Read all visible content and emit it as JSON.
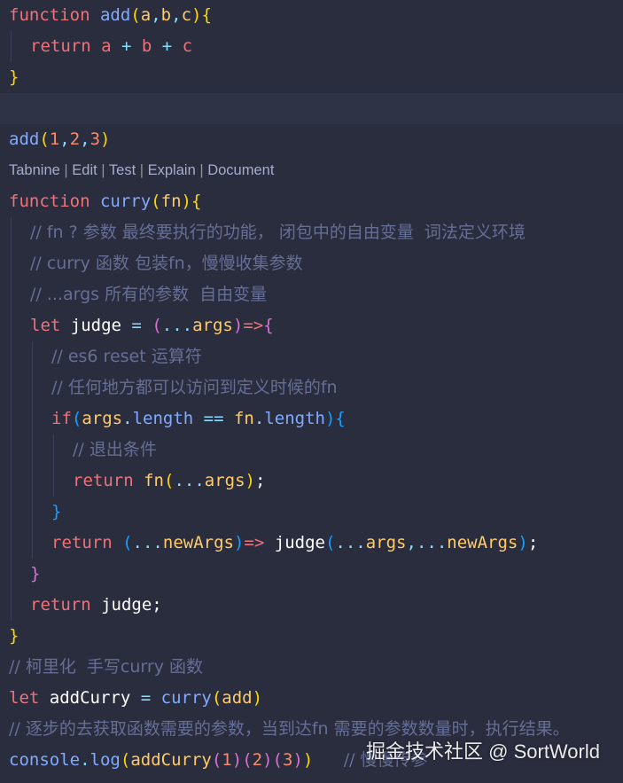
{
  "theme": {
    "background": "#292d3e",
    "keyword": "#f07178",
    "function": "#82aaff",
    "variable": "#ffcb6b",
    "operator": "#89ddff",
    "number": "#f78c6c",
    "comment": "#676e95",
    "bracket_level_1": "#ffd700",
    "bracket_level_2": "#da70d6",
    "bracket_level_3": "#179fff"
  },
  "codelens": {
    "items": [
      "Tabnine",
      "Edit",
      "Test",
      "Explain",
      "Document"
    ],
    "separator": " | "
  },
  "watermark": "掘金技术社区 @ SortWorld",
  "lines": [
    {
      "tokens": [
        {
          "t": "function",
          "c": "kw"
        },
        {
          "t": " ",
          "c": "tx"
        },
        {
          "t": "add",
          "c": "fn"
        },
        {
          "t": "(",
          "c": "b1"
        },
        {
          "t": "a",
          "c": "var"
        },
        {
          "t": ",",
          "c": "op"
        },
        {
          "t": "b",
          "c": "var"
        },
        {
          "t": ",",
          "c": "op"
        },
        {
          "t": "c",
          "c": "var"
        },
        {
          "t": ")",
          "c": "b1"
        },
        {
          "t": "{",
          "c": "b1"
        }
      ]
    },
    {
      "indent": 1,
      "tokens": [
        {
          "t": "return",
          "c": "kw"
        },
        {
          "t": " a ",
          "c": "kw"
        },
        {
          "t": "+",
          "c": "op"
        },
        {
          "t": " b ",
          "c": "kw"
        },
        {
          "t": "+",
          "c": "op"
        },
        {
          "t": " c",
          "c": "kw"
        }
      ]
    },
    {
      "tokens": [
        {
          "t": "}",
          "c": "b1"
        }
      ]
    },
    {
      "highlight": true,
      "tokens": []
    },
    {
      "tokens": [
        {
          "t": "add",
          "c": "fn"
        },
        {
          "t": "(",
          "c": "b1"
        },
        {
          "t": "1",
          "c": "num"
        },
        {
          "t": ",",
          "c": "op"
        },
        {
          "t": "2",
          "c": "num"
        },
        {
          "t": ",",
          "c": "op"
        },
        {
          "t": "3",
          "c": "num"
        },
        {
          "t": ")",
          "c": "b1"
        }
      ]
    },
    {
      "codelens": true
    },
    {
      "tokens": [
        {
          "t": "function",
          "c": "kw"
        },
        {
          "t": " ",
          "c": "tx"
        },
        {
          "t": "curry",
          "c": "fn"
        },
        {
          "t": "(",
          "c": "b1"
        },
        {
          "t": "fn",
          "c": "var"
        },
        {
          "t": ")",
          "c": "b1"
        },
        {
          "t": "{",
          "c": "b1"
        }
      ]
    },
    {
      "indent": 1,
      "tokens": [
        {
          "t": "// fn ? 参数 最终要执行的功能， 闭包中的自由变量  词法定义环境",
          "c": "cm"
        }
      ]
    },
    {
      "indent": 1,
      "tokens": [
        {
          "t": "// curry 函数 包装fn，慢慢收集参数",
          "c": "cm"
        }
      ]
    },
    {
      "indent": 1,
      "tokens": [
        {
          "t": "// ...args 所有的参数  自由变量",
          "c": "cm"
        }
      ]
    },
    {
      "indent": 1,
      "tokens": [
        {
          "t": "let",
          "c": "kw"
        },
        {
          "t": " ",
          "c": "tx"
        },
        {
          "t": "judge",
          "c": "pl"
        },
        {
          "t": " = ",
          "c": "op"
        },
        {
          "t": "(",
          "c": "b2"
        },
        {
          "t": "...",
          "c": "op"
        },
        {
          "t": "args",
          "c": "var"
        },
        {
          "t": ")",
          "c": "b2"
        },
        {
          "t": "=>",
          "c": "kw"
        },
        {
          "t": "{",
          "c": "b2"
        }
      ]
    },
    {
      "indent": 2,
      "tokens": [
        {
          "t": "// es6 reset 运算符",
          "c": "cm"
        }
      ]
    },
    {
      "indent": 2,
      "tokens": [
        {
          "t": "// 任何地方都可以访问到定义时候的fn",
          "c": "cm"
        }
      ]
    },
    {
      "indent": 2,
      "tokens": [
        {
          "t": "if",
          "c": "kw"
        },
        {
          "t": "(",
          "c": "b3"
        },
        {
          "t": "args",
          "c": "var"
        },
        {
          "t": ".",
          "c": "op"
        },
        {
          "t": "length",
          "c": "fn"
        },
        {
          "t": " == ",
          "c": "op"
        },
        {
          "t": "fn",
          "c": "var"
        },
        {
          "t": ".",
          "c": "op"
        },
        {
          "t": "length",
          "c": "fn"
        },
        {
          "t": ")",
          "c": "b3"
        },
        {
          "t": "{",
          "c": "b3"
        }
      ]
    },
    {
      "indent": 3,
      "tokens": [
        {
          "t": "// 退出条件",
          "c": "cm"
        }
      ]
    },
    {
      "indent": 3,
      "tokens": [
        {
          "t": "return",
          "c": "kw"
        },
        {
          "t": " ",
          "c": "tx"
        },
        {
          "t": "fn",
          "c": "var"
        },
        {
          "t": "(",
          "c": "b4"
        },
        {
          "t": "...",
          "c": "op"
        },
        {
          "t": "args",
          "c": "var"
        },
        {
          "t": ")",
          "c": "b4"
        },
        {
          "t": ";",
          "c": "pl"
        }
      ]
    },
    {
      "indent": 2,
      "tokens": [
        {
          "t": "}",
          "c": "b3"
        }
      ]
    },
    {
      "indent": 2,
      "tokens": [
        {
          "t": "return",
          "c": "kw"
        },
        {
          "t": " ",
          "c": "tx"
        },
        {
          "t": "(",
          "c": "b3"
        },
        {
          "t": "...",
          "c": "op"
        },
        {
          "t": "newArgs",
          "c": "var"
        },
        {
          "t": ")",
          "c": "b3"
        },
        {
          "t": "=>",
          "c": "kw"
        },
        {
          "t": " ",
          "c": "tx"
        },
        {
          "t": "judge",
          "c": "pl"
        },
        {
          "t": "(",
          "c": "b3"
        },
        {
          "t": "...",
          "c": "op"
        },
        {
          "t": "args",
          "c": "var"
        },
        {
          "t": ",",
          "c": "op"
        },
        {
          "t": "...",
          "c": "op"
        },
        {
          "t": "newArgs",
          "c": "var"
        },
        {
          "t": ")",
          "c": "b3"
        },
        {
          "t": ";",
          "c": "pl"
        }
      ]
    },
    {
      "indent": 1,
      "tokens": [
        {
          "t": "}",
          "c": "b2"
        }
      ]
    },
    {
      "indent": 1,
      "tokens": [
        {
          "t": "return",
          "c": "kw"
        },
        {
          "t": " ",
          "c": "tx"
        },
        {
          "t": "judge",
          "c": "pl"
        },
        {
          "t": ";",
          "c": "pl"
        }
      ]
    },
    {
      "tokens": [
        {
          "t": "}",
          "c": "b1"
        }
      ]
    },
    {
      "tokens": [
        {
          "t": "// 柯里化  手写curry 函数",
          "c": "cm"
        }
      ]
    },
    {
      "tokens": [
        {
          "t": "let",
          "c": "kw"
        },
        {
          "t": " ",
          "c": "tx"
        },
        {
          "t": "addCurry",
          "c": "pl"
        },
        {
          "t": " = ",
          "c": "op"
        },
        {
          "t": "curry",
          "c": "fn"
        },
        {
          "t": "(",
          "c": "b1"
        },
        {
          "t": "add",
          "c": "var"
        },
        {
          "t": ")",
          "c": "b1"
        }
      ]
    },
    {
      "tokens": [
        {
          "t": "// 逐步的去获取函数需要的参数，当到达fn 需要的参数数量时，执行结果。",
          "c": "cm"
        }
      ]
    },
    {
      "tokens": [
        {
          "t": "console",
          "c": "fn"
        },
        {
          "t": ".",
          "c": "op"
        },
        {
          "t": "log",
          "c": "fn"
        },
        {
          "t": "(",
          "c": "b1"
        },
        {
          "t": "addCurry",
          "c": "var"
        },
        {
          "t": "(",
          "c": "b2"
        },
        {
          "t": "1",
          "c": "num"
        },
        {
          "t": ")",
          "c": "b2"
        },
        {
          "t": "(",
          "c": "b2"
        },
        {
          "t": "2",
          "c": "num"
        },
        {
          "t": ")",
          "c": "b2"
        },
        {
          "t": "(",
          "c": "b2"
        },
        {
          "t": "3",
          "c": "num"
        },
        {
          "t": ")",
          "c": "b2"
        },
        {
          "t": ")",
          "c": "b1"
        },
        {
          "t": "   ",
          "c": "tx"
        },
        {
          "t": "// 慢慢传参",
          "c": "cm"
        }
      ]
    }
  ]
}
